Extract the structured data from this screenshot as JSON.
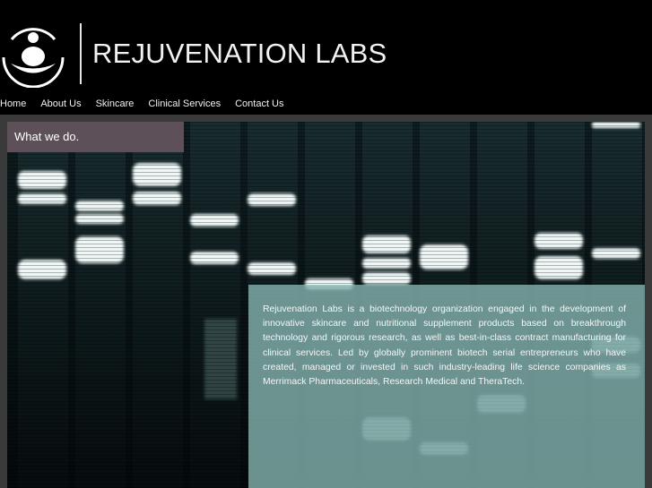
{
  "brand": {
    "name": "REJUVENATION LABS",
    "logo_icon": "rejuvenation-labs-logo-icon"
  },
  "nav": {
    "items": [
      {
        "label": "Home"
      },
      {
        "label": "About Us"
      },
      {
        "label": "Skincare"
      },
      {
        "label": "Clinical Services"
      },
      {
        "label": "Contact Us"
      }
    ]
  },
  "hero": {
    "heading": "What we do.",
    "body": "Rejuvenation Labs is a biotechnology organization engaged in the development of innovative skincare and nutritional supplement products based on breakthrough technology and rigorous research, as well as best-in-class contract manufacturing for clinical services.  Led by globally prominent biotech serial entrepreneurs who have created, managed or invested in such industry-leading life science companies as Merrimack Pharmaceuticals, Research Medical and TheraTech."
  },
  "colors": {
    "header_background": "#000000",
    "heading_box": "#5d5058",
    "text_panel": "#88b7b3",
    "text": "#ffffff"
  }
}
